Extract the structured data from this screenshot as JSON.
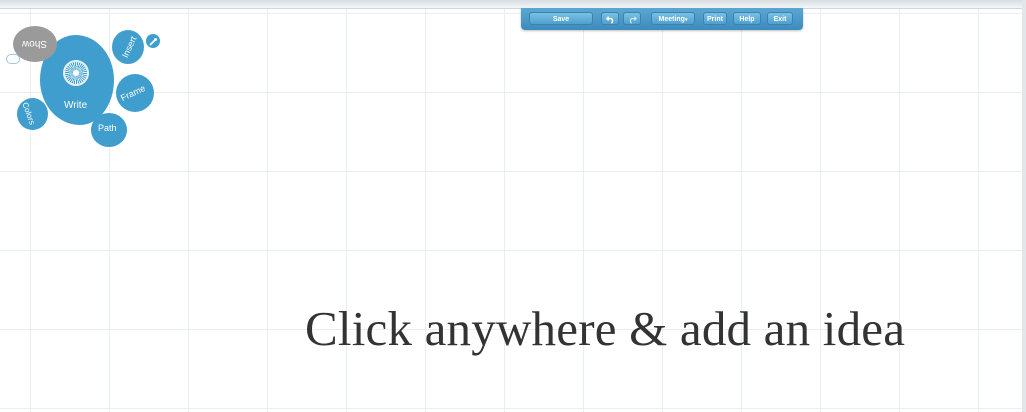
{
  "toolbar": {
    "save_label": "Save",
    "undo_icon": "undo-icon",
    "redo_icon": "redo-icon",
    "meeting_label": "Meeting",
    "meeting_arrow_icon": "dropdown-arrow-icon",
    "print_label": "Print",
    "help_label": "Help",
    "exit_label": "Exit"
  },
  "menu": {
    "show_label": "Show",
    "write_label": "Write",
    "insert_label": "Insert",
    "frame_label": "Frame",
    "path_label": "Path",
    "colors_label": "Colors",
    "wrench_icon": "wrench-icon",
    "zebra_icon": "transformation-zebra-icon"
  },
  "canvas": {
    "hint": "Click anywhere & add an idea"
  },
  "colors": {
    "bubble": "#3f9ecd",
    "show_bubble": "#9a9a9a",
    "toolbar": "#3c8bbd"
  }
}
